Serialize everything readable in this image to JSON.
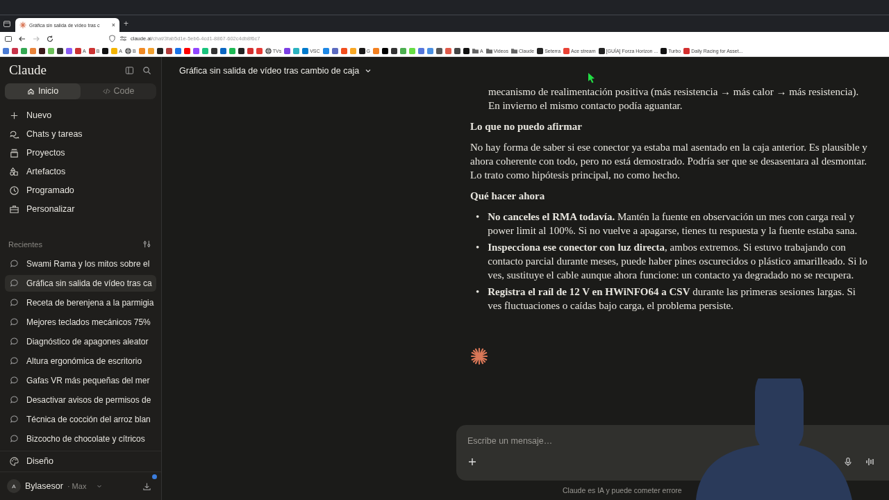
{
  "browser": {
    "tab": {
      "title": "Gráfica sin salida de vídeo tras c",
      "close": "×"
    },
    "new_tab": "+",
    "forward_disabled": true,
    "url": {
      "host": "claude.ai",
      "path": "/chat/3fab5d1e-5eb6-4cd1-8867-602c4db8f6c7"
    },
    "bookmarks": [
      {
        "kind": "site",
        "color": "#4a7bd4"
      },
      {
        "kind": "site",
        "color": "#c8334a"
      },
      {
        "kind": "site",
        "color": "#34a853"
      },
      {
        "kind": "site",
        "color": "#e8833a"
      },
      {
        "kind": "site",
        "color": "#3a1a1a"
      },
      {
        "kind": "site",
        "color": "#6bbf59"
      },
      {
        "kind": "site",
        "color": "#333333"
      },
      {
        "kind": "site",
        "color": "#8a5cf5"
      },
      {
        "kind": "site",
        "color": "#cc3333",
        "label": "A"
      },
      {
        "kind": "site",
        "color": "#cc3333",
        "label": "B"
      },
      {
        "kind": "site",
        "color": "#111111"
      },
      {
        "kind": "site",
        "color": "#f4b400",
        "label": "A"
      },
      {
        "kind": "globe",
        "color": "#555555",
        "label": "B"
      },
      {
        "kind": "site",
        "color": "#f08a24"
      },
      {
        "kind": "site",
        "color": "#f0a030"
      },
      {
        "kind": "site",
        "color": "#222222"
      },
      {
        "kind": "site",
        "color": "#b23a3a"
      },
      {
        "kind": "site",
        "color": "#1a73e8"
      },
      {
        "kind": "site",
        "color": "#ff0000"
      },
      {
        "kind": "site",
        "color": "#9146ff"
      },
      {
        "kind": "site",
        "color": "#19c37d"
      },
      {
        "kind": "site",
        "color": "#333333"
      },
      {
        "kind": "site",
        "color": "#0a66c2"
      },
      {
        "kind": "site",
        "color": "#1db954"
      },
      {
        "kind": "site",
        "color": "#222222"
      },
      {
        "kind": "site",
        "color": "#d32f2f"
      },
      {
        "kind": "site",
        "color": "#e53935"
      },
      {
        "kind": "globe",
        "color": "#555555",
        "label": "TVs"
      },
      {
        "kind": "site",
        "color": "#7b3fe4"
      },
      {
        "kind": "site",
        "color": "#2bb3c0"
      },
      {
        "kind": "site",
        "color": "#007acc",
        "label": "VSC"
      },
      {
        "kind": "site",
        "color": "#1e88e5"
      },
      {
        "kind": "site",
        "color": "#5c6bc0"
      },
      {
        "kind": "site",
        "color": "#f24e1e"
      },
      {
        "kind": "site",
        "color": "#f9a825"
      },
      {
        "kind": "site",
        "color": "#181717",
        "label": "G"
      },
      {
        "kind": "site",
        "color": "#f38020"
      },
      {
        "kind": "site",
        "color": "#000000"
      },
      {
        "kind": "site",
        "color": "#333333"
      },
      {
        "kind": "site",
        "color": "#4caf50"
      },
      {
        "kind": "site",
        "color": "#66dd44"
      },
      {
        "kind": "site",
        "color": "#5577dd"
      },
      {
        "kind": "site",
        "color": "#4a90e2"
      },
      {
        "kind": "site",
        "color": "#555555"
      },
      {
        "kind": "site",
        "color": "#e05a4a"
      },
      {
        "kind": "site",
        "color": "#444444"
      },
      {
        "kind": "site",
        "color": "#111111"
      },
      {
        "kind": "folder",
        "color": "#666666",
        "label": "A"
      },
      {
        "kind": "folder",
        "color": "#666666",
        "label": "Videos"
      },
      {
        "kind": "folder",
        "color": "#666666",
        "label": "Claude"
      },
      {
        "kind": "site",
        "color": "#222222",
        "label": "Seterra"
      },
      {
        "kind": "site",
        "color": "#e94235",
        "label": "Ace stream"
      },
      {
        "kind": "site",
        "color": "#222222",
        "label": "[GUÍA] Forza Horizon ..."
      },
      {
        "kind": "site",
        "color": "#111111",
        "label": "Turbo"
      },
      {
        "kind": "site",
        "color": "#d32f2f",
        "label": "Daily Racing for Asset..."
      }
    ]
  },
  "sidebar": {
    "logo": "Claude",
    "modes": [
      {
        "label": "Inicio",
        "kind": "home",
        "selected": true
      },
      {
        "label": "Code",
        "kind": "code",
        "selected": false
      }
    ],
    "nav": [
      {
        "label": "Nuevo",
        "kind": "plus"
      },
      {
        "label": "Chats y tareas",
        "kind": "chats"
      },
      {
        "label": "Proyectos",
        "kind": "projects"
      },
      {
        "label": "Artefactos",
        "kind": "artifacts"
      },
      {
        "label": "Programado",
        "kind": "clock"
      },
      {
        "label": "Personalizar",
        "kind": "briefcase"
      }
    ],
    "recents_label": "Recientes",
    "recents": [
      {
        "title": "Swami Rama y los mitos sobre el",
        "selected": false
      },
      {
        "title": "Gráfica sin salida de vídeo tras ca",
        "selected": true
      },
      {
        "title": "Receta de berenjena a la parmigia",
        "selected": false
      },
      {
        "title": "Mejores teclados mecánicos 75%",
        "selected": false
      },
      {
        "title": "Diagnóstico de apagones aleator",
        "selected": false
      },
      {
        "title": "Altura ergonómica de escritorio",
        "selected": false
      },
      {
        "title": "Gafas VR más pequeñas del mer",
        "selected": false
      },
      {
        "title": "Desactivar avisos de permisos de",
        "selected": false
      },
      {
        "title": "Técnica de cocción del arroz blan",
        "selected": false
      },
      {
        "title": "Bizcocho de chocolate y cítricos",
        "selected": false
      }
    ],
    "design": "Diseño",
    "user": {
      "initial": "A",
      "name": "Bylasesor",
      "plan": "· Max",
      "notification": true
    }
  },
  "chat": {
    "title": "Gráfica sin salida de vídeo tras cambio de caja",
    "blocks": [
      {
        "kind": "continuation",
        "text": "mecanismo de realimentación positiva (más resistencia → más calor → más resistencia). En invierno el mismo contacto podía aguantar."
      },
      {
        "kind": "heading",
        "text": "Lo que no puedo afirmar"
      },
      {
        "kind": "paragraph",
        "text": "No hay forma de saber si ese conector ya estaba mal asentado en la caja anterior. Es plausible y ahora coherente con todo, pero no está demostrado. Podría ser que se desasentara al desmontar. Lo trato como hipótesis principal, no como hecho."
      },
      {
        "kind": "heading",
        "text": "Qué hacer ahora"
      },
      {
        "kind": "bullets",
        "marker": "•",
        "items": [
          "**No canceles el RMA todavía.** Mantén la fuente en observación un mes con carga real y power limit al 100%. Si no vuelve a apagarse, tienes tu respuesta y la fuente estaba sana.",
          "**Inspecciona ese conector con luz directa**, ambos extremos. Si estuvo trabajando con contacto parcial durante meses, puede haber pines oscurecidos o plástico amarilleado. Si lo ves, sustituye el cable aunque ahora funcione: un contacto ya degradado no se recupera.",
          "**Registra el raíl de 12 V en HWiNFO64 a CSV** durante las primeras sesiones largas. Si ves fluctuaciones o caídas bajo carga, el problema persiste."
        ]
      }
    ],
    "composer": {
      "placeholder": "Escribe un mensaje…"
    },
    "disclaimer": "Claude es IA y puede cometer errore"
  }
}
